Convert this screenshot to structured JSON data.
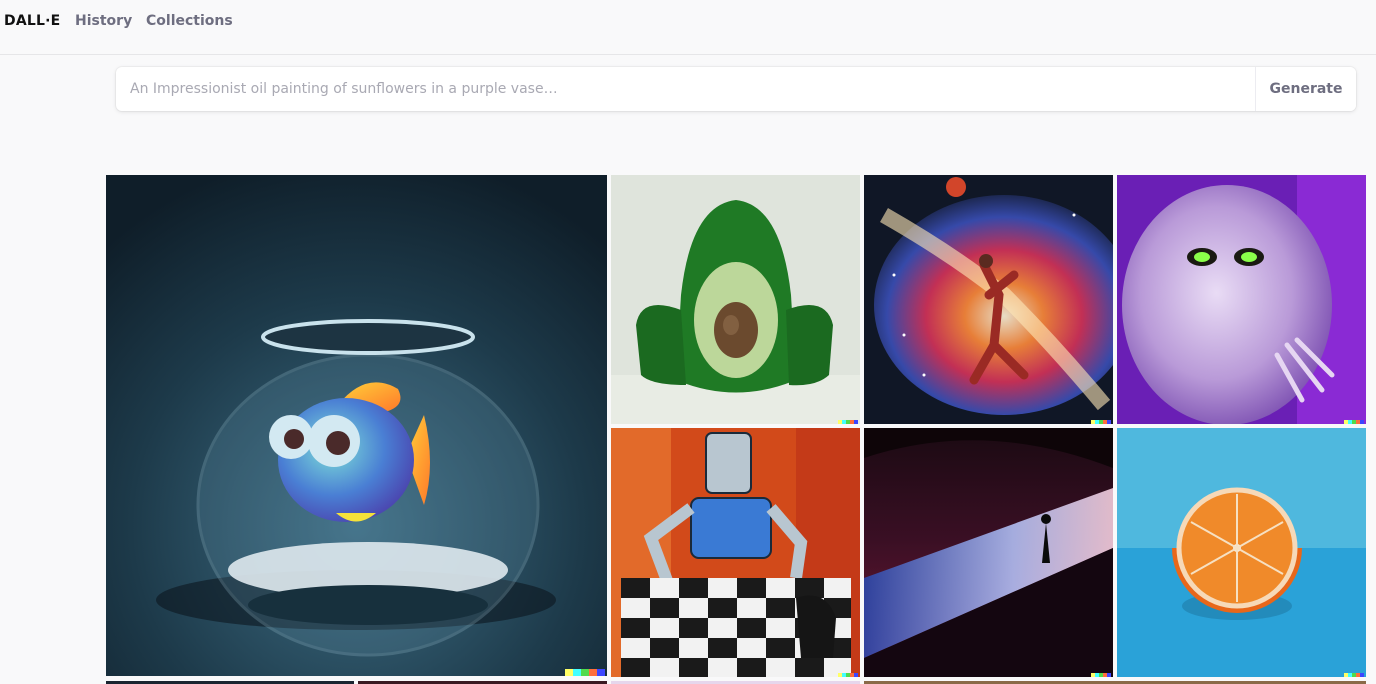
{
  "nav": {
    "brand": "DALL·E",
    "items": [
      {
        "label": "History"
      },
      {
        "label": "Collections"
      }
    ]
  },
  "prompt": {
    "placeholder": "An Impressionist oil painting of sunflowers in a purple vase…",
    "value": "",
    "generate_label": "Generate"
  },
  "gallery": {
    "images": [
      {
        "subject": "3D cartoon fish in a glass fishbowl"
      },
      {
        "subject": "armchair shaped like an avocado"
      },
      {
        "subject": "basketball player dunking in a colorful nebula"
      },
      {
        "subject": "purple furry monster with green eyes"
      },
      {
        "subject": "oil painting of a robot playing chess"
      },
      {
        "subject": "silhouette of a figure on a glowing dune"
      },
      {
        "subject": "halved orange on a blue surface"
      }
    ]
  },
  "watermark_colors": [
    "#ffff66",
    "#42ffff",
    "#51da4c",
    "#ff6e3c",
    "#3c46ff"
  ],
  "colors": {
    "background": "#f9f9fa",
    "nav_text": "#6e6e80",
    "brand_text": "#111111"
  }
}
